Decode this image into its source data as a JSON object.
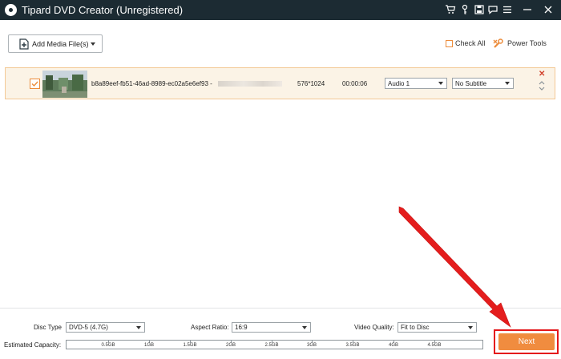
{
  "window": {
    "title": "Tipard DVD Creator (Unregistered)",
    "icons": [
      "cart-icon",
      "key-icon",
      "save-icon",
      "chat-icon",
      "menu-icon",
      "minimize-icon",
      "close-icon"
    ]
  },
  "toolbar": {
    "add_media_label": "Add Media File(s)",
    "check_all_label": "Check All",
    "power_tools_label": "Power Tools"
  },
  "media_item": {
    "file_name": "b8a89eef-fb51-46ad-8989-ec02a5e6ef93 -",
    "resolution": "576*1024",
    "duration": "00:00:06",
    "audio_track": "Audio 1",
    "subtitle": "No Subtitle",
    "checked": true
  },
  "settings": {
    "disc_type_label": "Disc Type",
    "disc_type_value": "DVD-5 (4.7G)",
    "aspect_ratio_label": "Aspect Ratio:",
    "aspect_ratio_value": "16:9",
    "video_quality_label": "Video Quality:",
    "video_quality_value": "Fit to Disc",
    "estimated_capacity_label": "Estimated Capacity:",
    "capacity_ticks": [
      "0.5GB",
      "1GB",
      "1.5GB",
      "2GB",
      "2.5GB",
      "3GB",
      "3.5GB",
      "4GB",
      "4.5GB"
    ]
  },
  "actions": {
    "next_label": "Next"
  },
  "colors": {
    "titlebar": "#1c2b33",
    "accent": "#f08c3f",
    "highlight": "#e4161b"
  }
}
